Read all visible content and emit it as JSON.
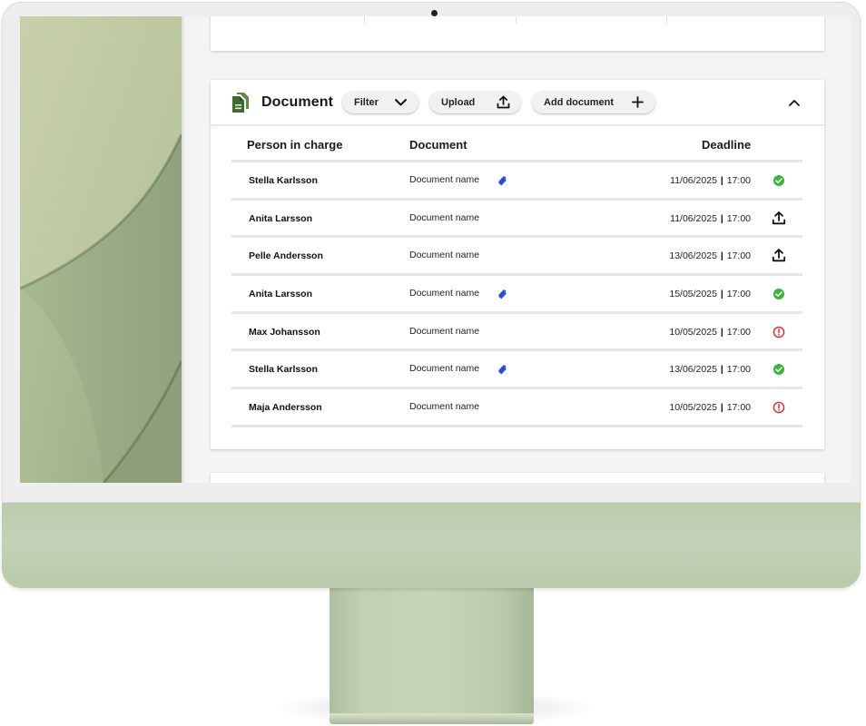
{
  "panel": {
    "title": "Document",
    "filter_label": "Filter",
    "upload_label": "Upload",
    "add_document_label": "Add document",
    "collapse_icon": "chevron-up-icon"
  },
  "table": {
    "headers": {
      "person": "Person in charge",
      "document": "Document",
      "deadline": "Deadline"
    },
    "rows": [
      {
        "person": "Stella Karlsson",
        "document": "Document name",
        "attachment": true,
        "date": "11/06/2025",
        "time": "17:00",
        "status": "done"
      },
      {
        "person": "Anita Larsson",
        "document": "Document name",
        "attachment": false,
        "date": "11/06/2025",
        "time": "17:00",
        "status": "upload"
      },
      {
        "person": "Pelle Andersson",
        "document": "Document name",
        "attachment": false,
        "date": "13/06/2025",
        "time": "17:00",
        "status": "upload"
      },
      {
        "person": "Anita Larsson",
        "document": "Document name",
        "attachment": true,
        "date": "15/05/2025",
        "time": "17:00",
        "status": "done"
      },
      {
        "person": "Max Johansson",
        "document": "Document name",
        "attachment": false,
        "date": "10/05/2025",
        "time": "17:00",
        "status": "overdue"
      },
      {
        "person": "Stella Karlsson",
        "document": "Document name",
        "attachment": true,
        "date": "13/06/2025",
        "time": "17:00",
        "status": "done"
      },
      {
        "person": "Maja Andersson",
        "document": "Document name",
        "attachment": false,
        "date": "10/05/2025",
        "time": "17:00",
        "status": "overdue"
      }
    ]
  },
  "colors": {
    "accent_green": "#3f6b2e",
    "status_done": "#3cb43c",
    "status_overdue": "#d92b2b",
    "attachment_blue": "#1f4fd6",
    "monitor_body": "#c0cfb2"
  }
}
